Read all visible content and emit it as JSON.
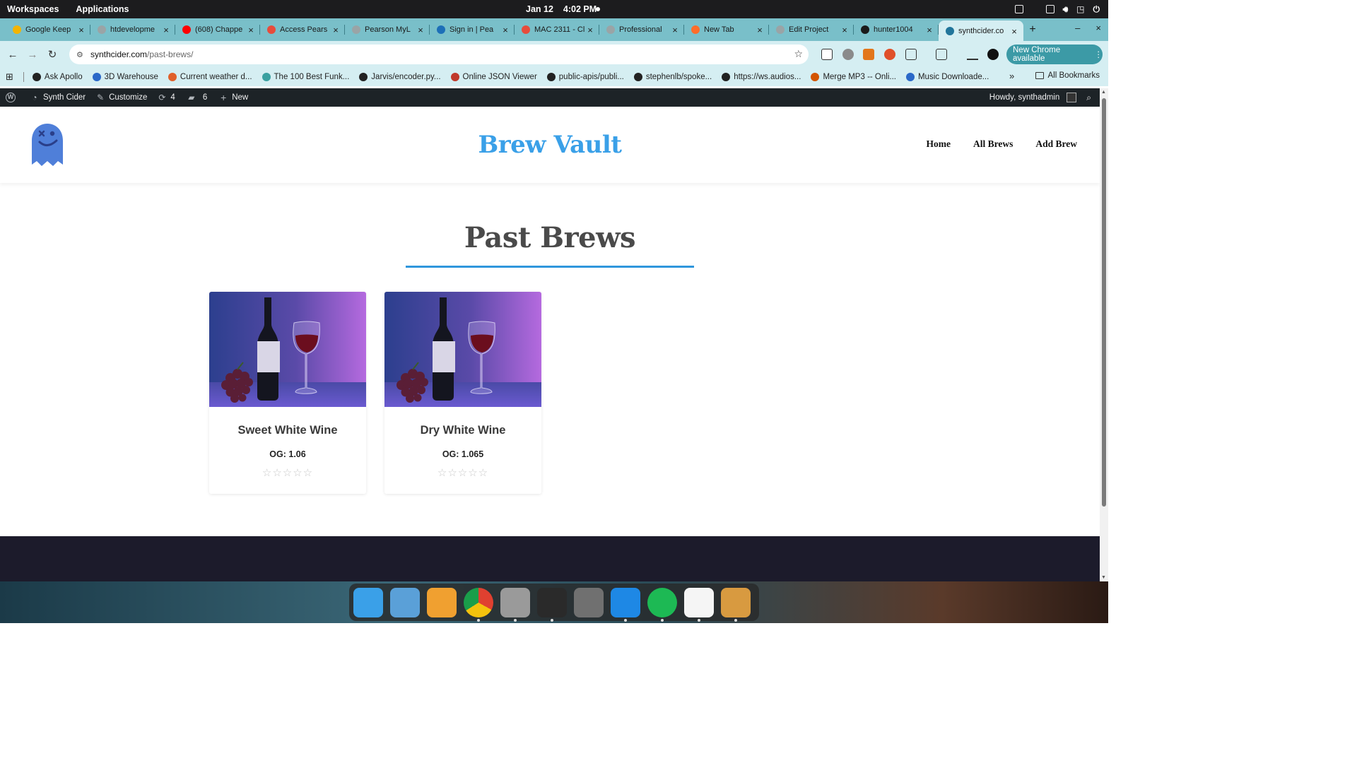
{
  "os": {
    "workspaces_label": "Workspaces",
    "applications_label": "Applications",
    "date": "Jan 12",
    "time": "4:02 PM"
  },
  "tabs": [
    {
      "title": "Google Keep",
      "color": "#f4b400"
    },
    {
      "title": "htdevelopme",
      "color": "#9aa4a6"
    },
    {
      "title": "(608) Chappe",
      "color": "#ff0000"
    },
    {
      "title": "Access Pears",
      "color": "#e74c3c"
    },
    {
      "title": "Pearson MyL",
      "color": "#9aa4a6"
    },
    {
      "title": "Sign in | Pea",
      "color": "#1d6fb8"
    },
    {
      "title": "MAC 2311 - Cl",
      "color": "#e74c3c"
    },
    {
      "title": "Professional",
      "color": "#9aa4a6"
    },
    {
      "title": "New Tab",
      "color": "#ff6d2a"
    },
    {
      "title": "Edit Project",
      "color": "#9aa4a6"
    },
    {
      "title": "hunter1004",
      "color": "#1a1a1a"
    },
    {
      "title": "synthcider.co",
      "color": "#21759b",
      "active": true
    }
  ],
  "address": {
    "host": "synthcider.com",
    "path": "/past-brews/"
  },
  "chrome_update_label": "New Chrome available",
  "bookmarks": [
    {
      "label": "Ask Apollo",
      "color": "#222"
    },
    {
      "label": "3D Warehouse",
      "color": "#2a68c8"
    },
    {
      "label": "Current weather d...",
      "color": "#e0602a"
    },
    {
      "label": "The 100 Best Funk...",
      "color": "#3aa0a0"
    },
    {
      "label": "Jarvis/encoder.py...",
      "color": "#222"
    },
    {
      "label": "Online JSON Viewer",
      "color": "#c0392b"
    },
    {
      "label": "public-apis/publi...",
      "color": "#222"
    },
    {
      "label": "stephenlb/spoke...",
      "color": "#222"
    },
    {
      "label": "https://ws.audios...",
      "color": "#222"
    },
    {
      "label": "Merge MP3 -- Onli...",
      "color": "#d35400"
    },
    {
      "label": "Music Downloade...",
      "color": "#2a68c8"
    }
  ],
  "all_bookmarks_label": "All Bookmarks",
  "wp_admin": {
    "site_name": "Synth Cider",
    "customize": "Customize",
    "updates_count": "4",
    "comments_count": "6",
    "new_label": "New",
    "howdy": "Howdy, synthadmin"
  },
  "site": {
    "title": "Brew Vault",
    "nav": [
      "Home",
      "All Brews",
      "Add Brew"
    ],
    "page_heading": "Past Brews",
    "brews": [
      {
        "name": "Sweet White Wine",
        "og": "OG: 1.06",
        "rating": 0,
        "max_rating": 5
      },
      {
        "name": "Dry White Wine",
        "og": "OG: 1.065",
        "rating": 0,
        "max_rating": 5
      }
    ]
  },
  "dock_apps": [
    {
      "name": "search-app",
      "color": "#3aa0e8"
    },
    {
      "name": "image-viewer",
      "color": "#5aa0d8"
    },
    {
      "name": "app-grid",
      "color": "#f0a030"
    },
    {
      "name": "chrome",
      "color": "#e04030"
    },
    {
      "name": "files",
      "color": "#9a9a9a"
    },
    {
      "name": "terminal",
      "color": "#2a2a2a"
    },
    {
      "name": "settings",
      "color": "#707070"
    },
    {
      "name": "vscode",
      "color": "#1e88e5"
    },
    {
      "name": "spotify",
      "color": "#1db954"
    },
    {
      "name": "text-editor",
      "color": "#f5f5f5"
    },
    {
      "name": "archive-manager",
      "color": "#d89a40"
    }
  ]
}
